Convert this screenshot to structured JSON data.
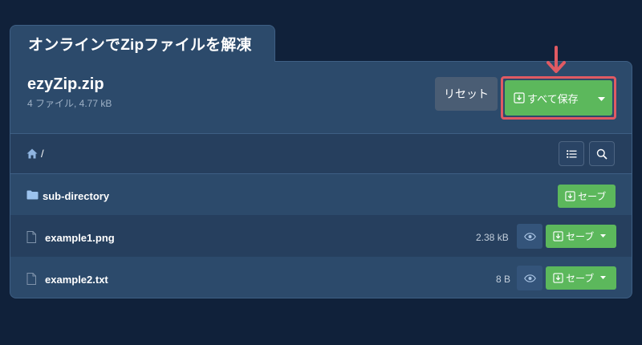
{
  "page": {
    "title": "オンラインでZipファイルを解凍"
  },
  "archive": {
    "name": "ezyZip.zip",
    "meta": "4 ファイル, 4.77 kB",
    "reset_label": "リセット",
    "save_all_label": "すべて保存"
  },
  "path": {
    "current": "/"
  },
  "rows": [
    {
      "name": "sub-directory",
      "type": "folder",
      "size": "",
      "save_label": "セーブ"
    },
    {
      "name": "example1.png",
      "type": "file",
      "size": "2.38 kB",
      "save_label": "セーブ"
    },
    {
      "name": "example2.txt",
      "type": "file",
      "size": "8 B",
      "save_label": "セーブ"
    }
  ],
  "colors": {
    "accent_green": "#5cb85c",
    "highlight_red": "#e05a63",
    "panel": "#2c4a6b",
    "background": "#10213a"
  },
  "icons": [
    "download-icon",
    "caret-down-icon",
    "home-icon",
    "list-icon",
    "search-icon",
    "folder-icon",
    "file-icon",
    "eye-icon",
    "arrow-down-icon"
  ]
}
